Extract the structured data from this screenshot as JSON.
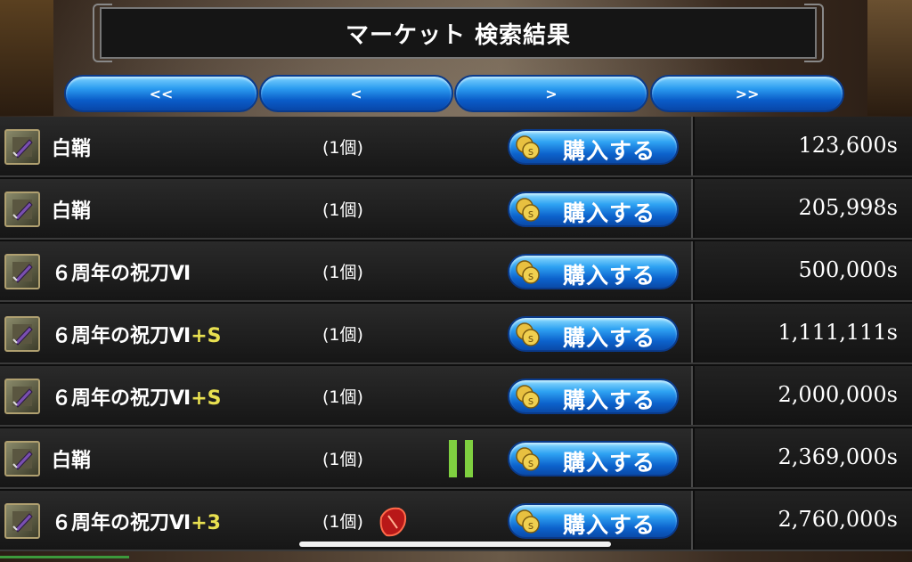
{
  "title": "マーケット 検索結果",
  "nav": {
    "first": "<<",
    "prev": "<",
    "next": ">",
    "last": ">>"
  },
  "buy_label": "購入する",
  "rows": [
    {
      "name": "白鞘",
      "suffix": "",
      "qty": "(1個)",
      "price": "123,600s",
      "marker": ""
    },
    {
      "name": "白鞘",
      "suffix": "",
      "qty": "(1個)",
      "price": "205,998s",
      "marker": ""
    },
    {
      "name": "６周年の祝刀Ⅵ",
      "suffix": "",
      "qty": "(1個)",
      "price": "500,000s",
      "marker": ""
    },
    {
      "name": "６周年の祝刀Ⅵ",
      "suffix": "+S",
      "qty": "(1個)",
      "price": "1,111,111s",
      "marker": ""
    },
    {
      "name": "６周年の祝刀Ⅵ",
      "suffix": "+S",
      "qty": "(1個)",
      "price": "2,000,000s",
      "marker": ""
    },
    {
      "name": "白鞘",
      "suffix": "",
      "qty": "(1個)",
      "price": "2,369,000s",
      "marker": "pause-icon"
    },
    {
      "name": "６周年の祝刀Ⅵ",
      "suffix": "+3",
      "qty": "(1個)",
      "price": "2,760,000s",
      "marker": "gem-icon"
    }
  ],
  "colors": {
    "button_blue": "#0c62cc",
    "suffix_yellow": "#e8e050",
    "pause_green": "#7fd040"
  }
}
